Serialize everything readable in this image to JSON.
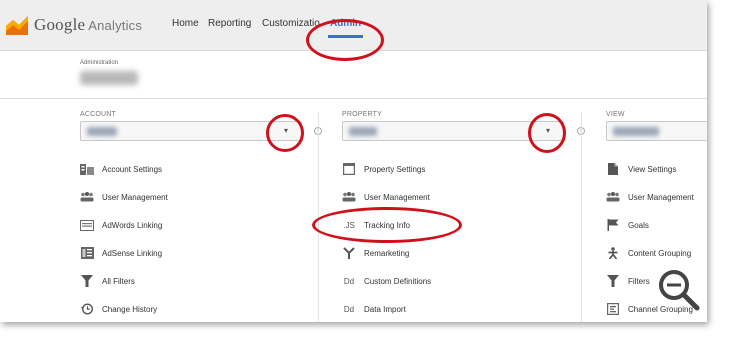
{
  "brand": {
    "name": "Google",
    "product": "Analytics"
  },
  "nav": {
    "home": "Home",
    "reporting": "Reporting",
    "customization": "Customizatio",
    "admin": "Admin"
  },
  "administration": {
    "label": "Administration"
  },
  "account": {
    "header": "ACCOUNT",
    "items": [
      {
        "label": "Account Settings",
        "icon": "account-settings-icon"
      },
      {
        "label": "User Management",
        "icon": "users-icon"
      },
      {
        "label": "AdWords Linking",
        "icon": "adwords-icon"
      },
      {
        "label": "AdSense Linking",
        "icon": "adsense-icon"
      },
      {
        "label": "All Filters",
        "icon": "filter-icon"
      },
      {
        "label": "Change History",
        "icon": "history-icon"
      }
    ]
  },
  "property": {
    "header": "PROPERTY",
    "items": [
      {
        "label": "Property Settings",
        "icon": "property-settings-icon"
      },
      {
        "label": "User Management",
        "icon": "users-icon"
      },
      {
        "label": "Tracking Info",
        "icon": "js-icon"
      },
      {
        "label": "Remarketing",
        "icon": "remarketing-icon"
      },
      {
        "label": "Custom Definitions",
        "icon": "dd-icon"
      },
      {
        "label": "Data Import",
        "icon": "dd-icon"
      }
    ]
  },
  "view": {
    "header": "VIEW",
    "items": [
      {
        "label": "View Settings",
        "icon": "document-icon"
      },
      {
        "label": "User Management",
        "icon": "users-icon"
      },
      {
        "label": "Goals",
        "icon": "flag-icon"
      },
      {
        "label": "Content Grouping",
        "icon": "person-icon"
      },
      {
        "label": "Filters",
        "icon": "filter-icon"
      },
      {
        "label": "Channel Grouping",
        "icon": "channel-icon"
      }
    ]
  },
  "icons": {
    "dd": "Dd",
    "js": ".JS"
  },
  "colors": {
    "highlight_circle": "#d0101a",
    "admin_blue": "#3f6ecb"
  }
}
